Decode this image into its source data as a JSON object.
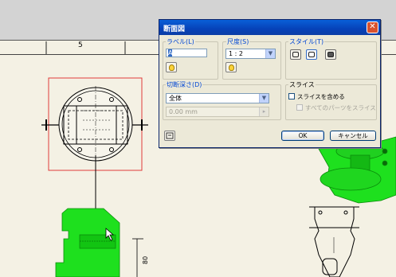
{
  "sheet": {
    "zone_label": "5",
    "dimension": "80",
    "colors": {
      "part_green": "#1ee01e",
      "section_box": "#e02020",
      "paper": "#f4f1e4"
    }
  },
  "dialog": {
    "title": "断面図",
    "close_icon": "close-icon",
    "label_group": {
      "title": "ラベル(L)",
      "value": "A",
      "icon": "bulb-icon"
    },
    "scale_group": {
      "title": "尺度(S)",
      "value": "1 : 2",
      "icon": "bulb-icon"
    },
    "style_group": {
      "title": "スタイル(T)",
      "icons": [
        "style-hidden-icon",
        "style-visible-icon",
        "style-shaded-icon"
      ]
    },
    "depth_group": {
      "title": "切断深さ(D)",
      "value": "全体",
      "distance_placeholder": "0.00 mm"
    },
    "slice_group": {
      "title": "スライス",
      "include_slice_label": "スライスを含める",
      "slice_all_label": "すべてのパーツをスライス"
    },
    "help_icon": "help-icon",
    "ok_label": "OK",
    "cancel_label": "キャンセル"
  }
}
